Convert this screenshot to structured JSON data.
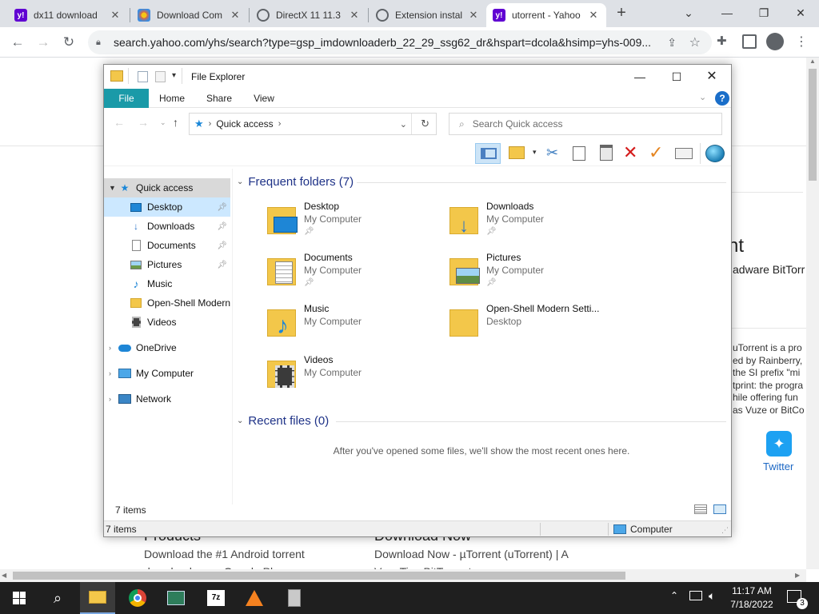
{
  "browser": {
    "tabs": [
      {
        "title": "dx11 download",
        "fav_letter": "y!",
        "fav_color": "#6001d2",
        "active": false
      },
      {
        "title": "Download Com",
        "fav_letter": "",
        "fav_color": "#e8a33d",
        "active": false
      },
      {
        "title": "DirectX 11 11.3",
        "fav_letter": "",
        "fav_color": "#5f6368",
        "active": false
      },
      {
        "title": "Extension instal",
        "fav_letter": "",
        "fav_color": "#5f6368",
        "active": false
      },
      {
        "title": "utorrent - Yahoo",
        "fav_letter": "y!",
        "fav_color": "#6001d2",
        "active": true
      }
    ],
    "new_tab": "+",
    "url": "search.yahoo.com/yhs/search?type=gsp_imdownloaderb_22_29_ssg62_dr&hspart=dcola&hsimp=yhs-009..."
  },
  "page_bg": {
    "heading_fragment": "nt",
    "subtitle_fragment": "adware BitTorr",
    "desc_lines": [
      "uTorrent is a pro",
      "ed by Rainberry,",
      "the SI prefix \"mi",
      "tprint: the progra",
      "hile offering fun",
      "as Vuze or BitCo"
    ],
    "twitter_label": "Twitter",
    "products_heading": "Products",
    "products_text": "Download the #1 Android torrent",
    "products_text2": "download app - Google Pla...",
    "download_heading": "Download Now",
    "download_text": "Download Now - µTorrent (uTorrent) | A",
    "download_text2": "Very Tiny BitTorrent..."
  },
  "explorer": {
    "title": "File Explorer",
    "ribbon_tabs": [
      "File",
      "Home",
      "Share",
      "View"
    ],
    "address": "Quick access",
    "search_placeholder": "Search Quick access",
    "nav": {
      "quick_access": "Quick access",
      "items": [
        {
          "label": "Desktop",
          "icon": "desktop-icon",
          "pinned": true
        },
        {
          "label": "Downloads",
          "icon": "downloads-icon",
          "pinned": true
        },
        {
          "label": "Documents",
          "icon": "documents-icon",
          "pinned": true
        },
        {
          "label": "Pictures",
          "icon": "pictures-icon",
          "pinned": true
        },
        {
          "label": "Music",
          "icon": "music-icon",
          "pinned": false
        },
        {
          "label": "Open-Shell Modern",
          "icon": "folder-icon",
          "pinned": false
        },
        {
          "label": "Videos",
          "icon": "videos-icon",
          "pinned": false
        }
      ],
      "roots": [
        "OneDrive",
        "My Computer",
        "Network"
      ]
    },
    "frequent_heading": "Frequent folders (7)",
    "folders": [
      {
        "name": "Desktop",
        "location": "My Computer",
        "pinned": true,
        "icon": "desktop-folder-icon"
      },
      {
        "name": "Downloads",
        "location": "My Computer",
        "pinned": true,
        "icon": "downloads-folder-icon"
      },
      {
        "name": "Documents",
        "location": "My Computer",
        "pinned": true,
        "icon": "documents-folder-icon"
      },
      {
        "name": "Pictures",
        "location": "My Computer",
        "pinned": true,
        "icon": "pictures-folder-icon"
      },
      {
        "name": "Music",
        "location": "My Computer",
        "pinned": false,
        "icon": "music-folder-icon"
      },
      {
        "name": "Open-Shell Modern Setti...",
        "location": "Desktop",
        "pinned": false,
        "icon": "folder-icon"
      },
      {
        "name": "Videos",
        "location": "My Computer",
        "pinned": false,
        "icon": "videos-folder-icon"
      }
    ],
    "recent_heading": "Recent files (0)",
    "recent_empty": "After you've opened some files, we'll show the most recent ones here.",
    "status_count": "7 items",
    "status_bar_count": "7 items",
    "status_bar_location": "Computer"
  },
  "taskbar": {
    "time": "11:17 AM",
    "date": "7/18/2022",
    "notification_count": "3"
  }
}
